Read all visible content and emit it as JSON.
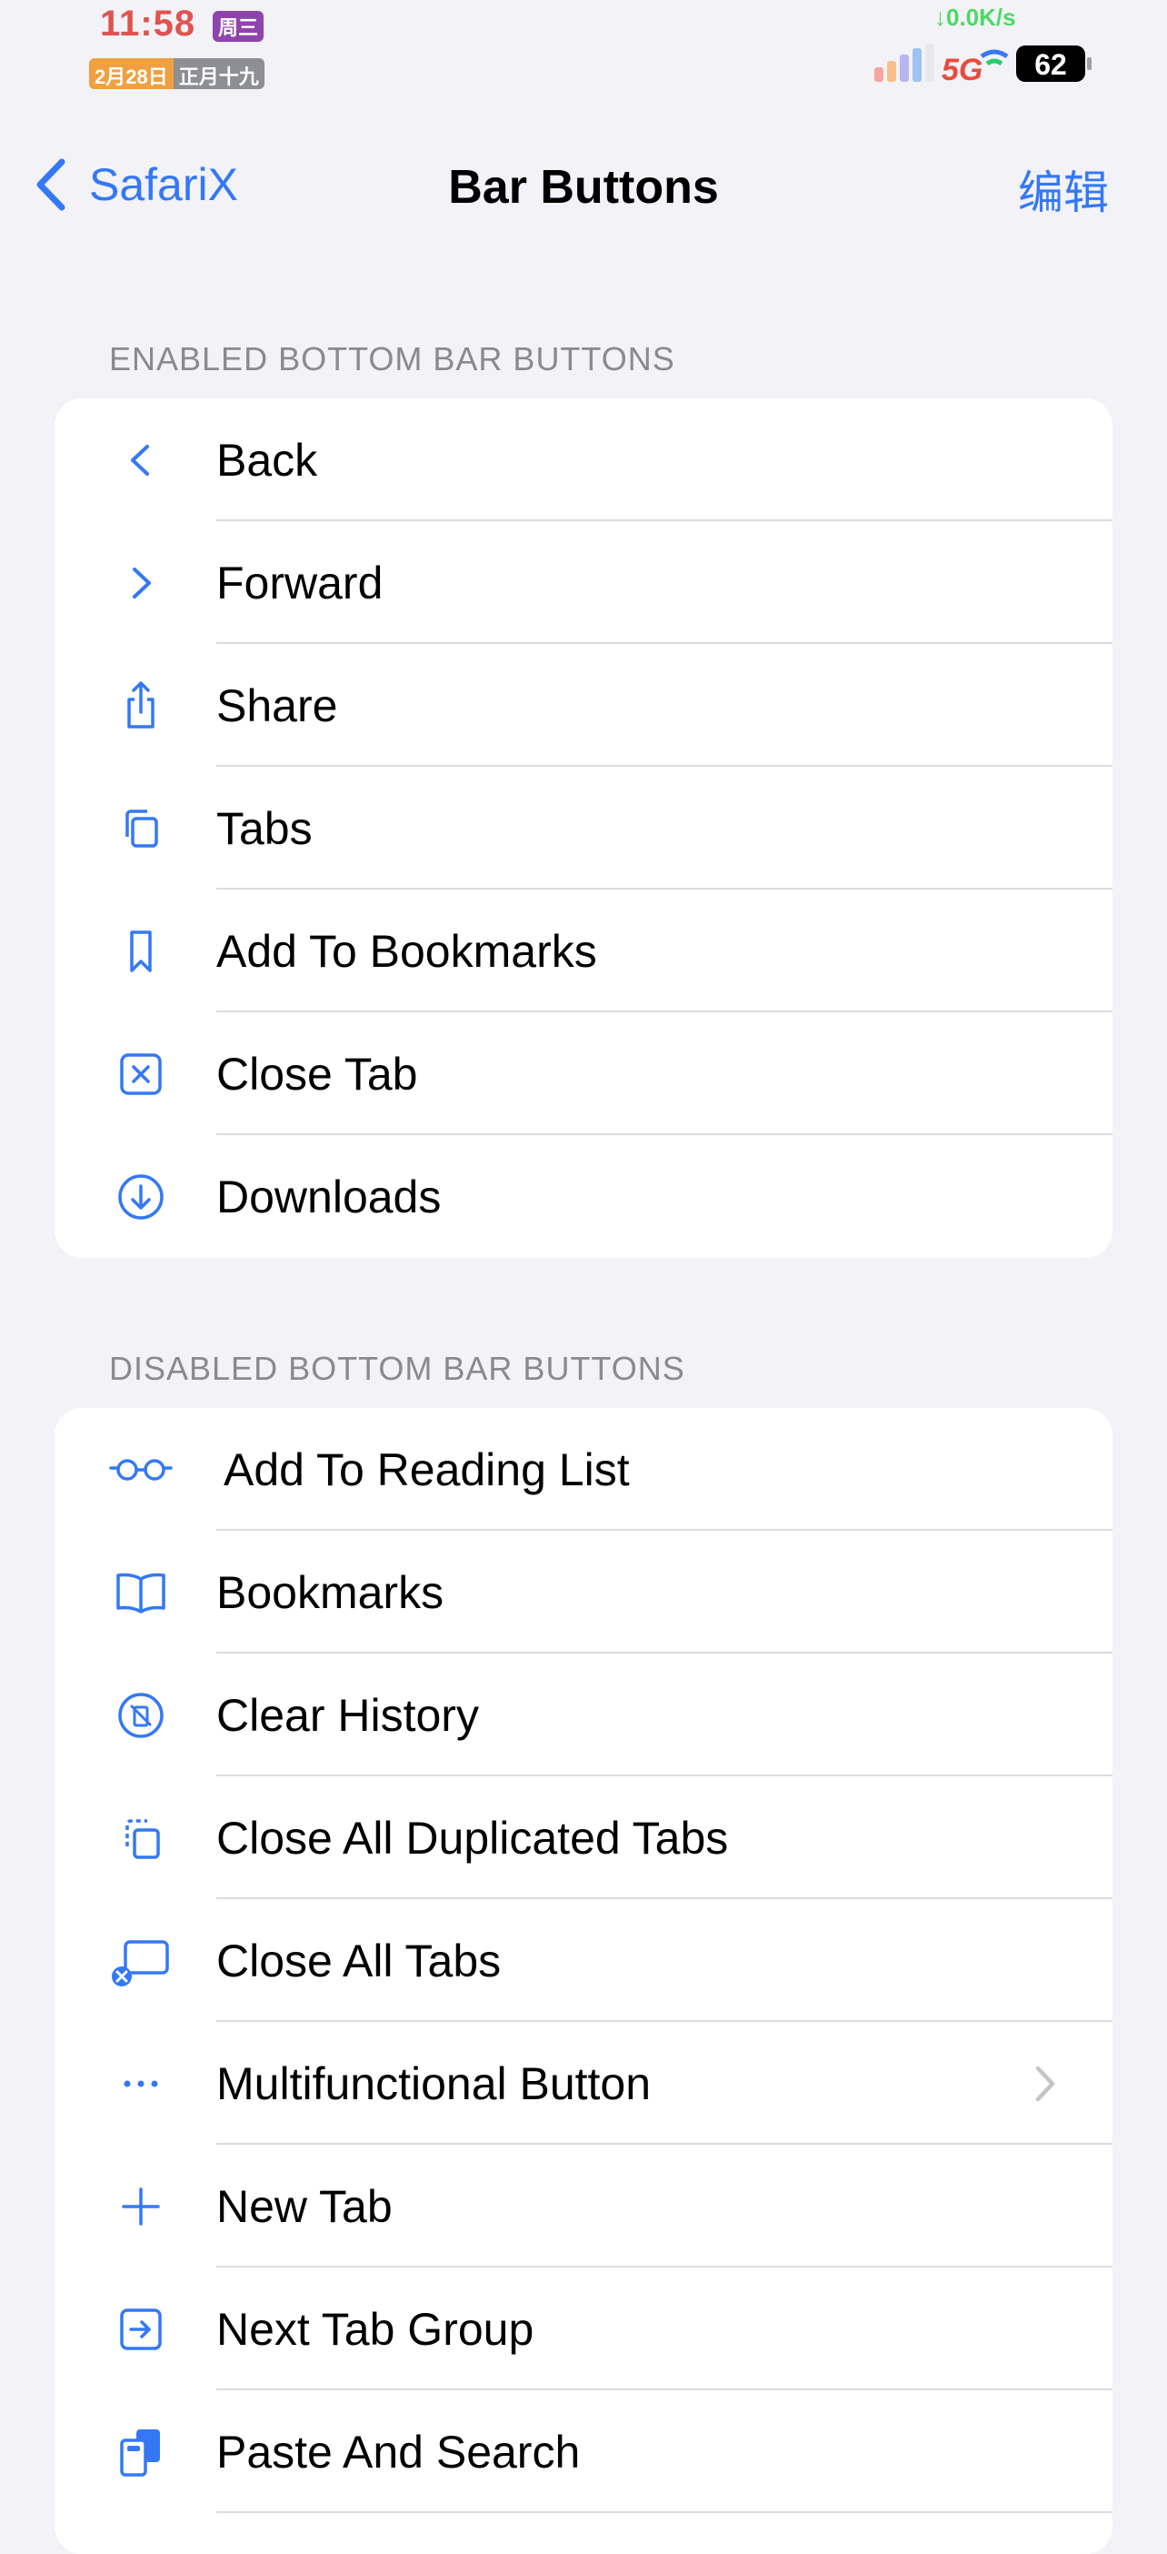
{
  "status_bar": {
    "time": "11:58",
    "weekday": "周三",
    "date": "2月28日",
    "lunar": "正月十九",
    "net_speed": "↓0.0K/s",
    "network": "5G",
    "battery": "62"
  },
  "nav": {
    "back_label": "SafariX",
    "title": "Bar Buttons",
    "edit_label": "编辑"
  },
  "enabled_section": {
    "header": "ENABLED BOTTOM BAR BUTTONS",
    "items": [
      {
        "label": "Back",
        "icon": "chevron-left-icon"
      },
      {
        "label": "Forward",
        "icon": "chevron-right-icon"
      },
      {
        "label": "Share",
        "icon": "share-icon"
      },
      {
        "label": "Tabs",
        "icon": "tabs-icon"
      },
      {
        "label": "Add To Bookmarks",
        "icon": "bookmark-icon"
      },
      {
        "label": "Close Tab",
        "icon": "close-tab-icon"
      },
      {
        "label": "Downloads",
        "icon": "download-icon"
      }
    ]
  },
  "disabled_section": {
    "header": "DISABLED BOTTOM BAR BUTTONS",
    "items": [
      {
        "label": "Add To Reading List",
        "icon": "glasses-icon"
      },
      {
        "label": "Bookmarks",
        "icon": "book-icon"
      },
      {
        "label": "Clear History",
        "icon": "clear-history-icon"
      },
      {
        "label": "Close All Duplicated Tabs",
        "icon": "duplicate-tabs-icon"
      },
      {
        "label": "Close All Tabs",
        "icon": "close-all-tabs-icon"
      },
      {
        "label": "Multifunctional Button",
        "icon": "ellipsis-icon"
      },
      {
        "label": "New Tab",
        "icon": "plus-icon"
      },
      {
        "label": "Next Tab Group",
        "icon": "next-tab-group-icon"
      },
      {
        "label": "Paste And Search",
        "icon": "paste-search-icon"
      }
    ]
  },
  "colors": {
    "accent": "#3478f6",
    "background": "#f2f2f7",
    "time_color": "#e0534f"
  }
}
